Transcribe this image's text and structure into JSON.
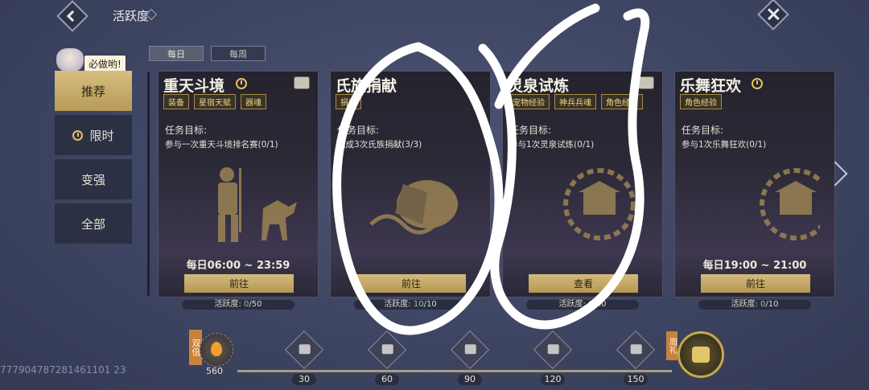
{
  "header": {
    "title": "活跃度"
  },
  "nav": {
    "speech": "必做哟!",
    "items": [
      {
        "label": "推荐",
        "active": true
      },
      {
        "label": "限时",
        "active": false,
        "icon": "clock-icon"
      },
      {
        "label": "变强",
        "active": false
      },
      {
        "label": "全部",
        "active": false
      }
    ]
  },
  "tabs": [
    {
      "label": "每日",
      "active": true
    },
    {
      "label": "每周",
      "active": false
    }
  ],
  "cards": [
    {
      "title": "重天斗境",
      "tags": [
        "装备",
        "星宿天赋",
        "器魂"
      ],
      "goal_label": "任务目标:",
      "goal": "参与一次重天斗境排名赛(0/1)",
      "time": "每日06:00 ~ 23:59",
      "button": "前往",
      "activity_label": "活跃度:",
      "activity_done": "0",
      "activity_total": "/50"
    },
    {
      "title": "氏族捐献",
      "tags": [
        "捐献"
      ],
      "goal_label": "任务目标:",
      "goal": "完成3次氏族捐献(3/3)",
      "time": "",
      "button": "前往",
      "activity_label": "活跃度:",
      "activity_done": "10",
      "activity_total": "/10"
    },
    {
      "title": "灵泉试炼",
      "tags": [
        "宠物经验",
        "神兵兵魂",
        "角色经验"
      ],
      "goal_label": "任务目标:",
      "goal": "参与1次灵泉试炼(0/1)",
      "time": "",
      "button": "查看",
      "activity_label": "活跃度:",
      "activity_done": "0",
      "activity_total": "/40"
    },
    {
      "title": "乐舞狂欢",
      "tags": [
        "角色经验"
      ],
      "goal_label": "任务目标:",
      "goal": "参与1次乐舞狂欢(0/1)",
      "time": "每日19:00 ~ 21:00",
      "button": "前往",
      "activity_label": "活跃度:",
      "activity_done": "0",
      "activity_total": "/10"
    }
  ],
  "progress": {
    "double_label": "双倍",
    "score": "560",
    "milestones": [
      "30",
      "60",
      "90",
      "120",
      "150"
    ],
    "big_reward_tag": "周礼"
  },
  "uid": "777904787281461101 23"
}
